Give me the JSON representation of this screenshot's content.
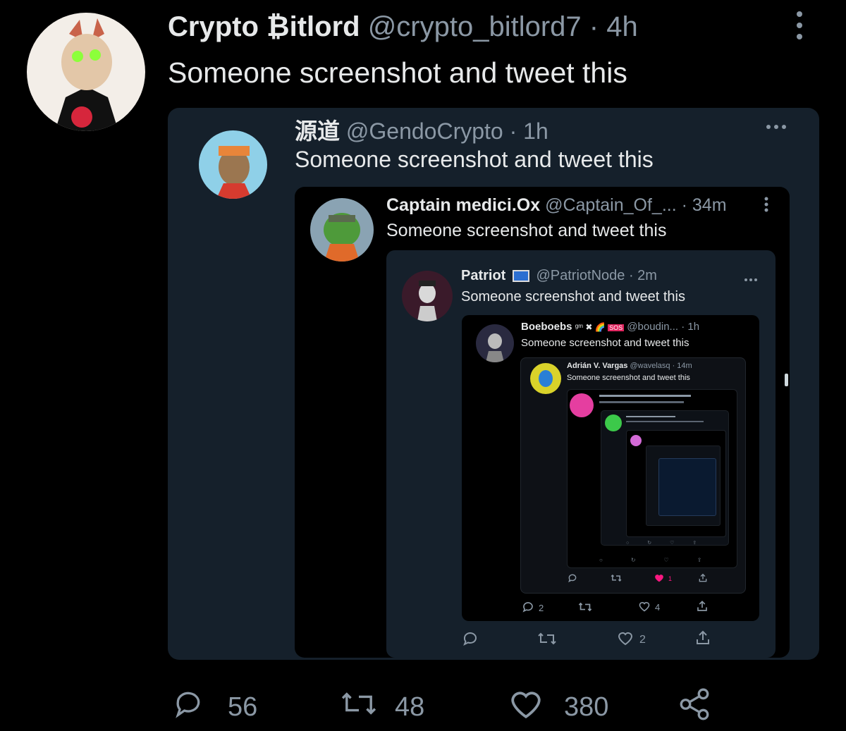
{
  "tweet": {
    "display_name": "Crypto ₿itlord",
    "handle": "@crypto_bitlord7",
    "time": "· 4h",
    "text": "Someone screenshot and tweet this",
    "stats": {
      "replies": "56",
      "retweets": "48",
      "likes": "380"
    }
  },
  "embedded": [
    {
      "name": "源道",
      "handle": "@GendoCrypto",
      "time": "· 1h",
      "text": "Someone screenshot and tweet this"
    },
    {
      "name": "Captain medici.Ox",
      "handle": "@Captain_Of_...",
      "time": "· 34m",
      "text": "Someone screenshot and tweet this"
    },
    {
      "name": "Patriot",
      "handle": "@PatriotNode",
      "time": "· 2m",
      "text": "Someone screenshot and tweet this",
      "likes": "2"
    },
    {
      "name": "Boeboebs",
      "handle": "@boudin...",
      "time": "· 1h",
      "text": "Someone screenshot and tweet this",
      "replies": "2",
      "likes": "4"
    },
    {
      "name": "Adrián V. Vargas",
      "handle": "@wavelasq",
      "time": "· 14m",
      "text": "Someone screenshot and tweet this",
      "likes": "1"
    }
  ],
  "icons": {
    "reply": "speech-bubble-icon",
    "retweet": "retweet-arrows-icon",
    "like": "heart-icon",
    "share": "share-icon",
    "more": "more-dots-icon"
  },
  "colors": {
    "background": "#000000",
    "card": "#15202b",
    "text": "#e7e9ea",
    "muted": "#8b98a5",
    "heart_active": "#f91880"
  }
}
